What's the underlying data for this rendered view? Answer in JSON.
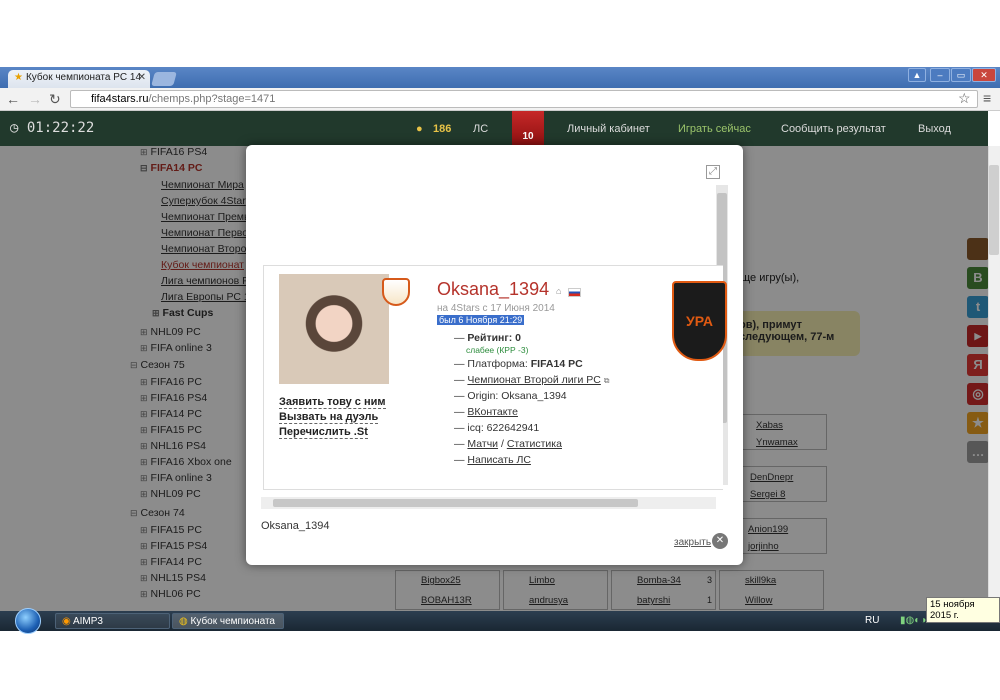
{
  "browser": {
    "tab_title": "Кубок чемпионата PC 14",
    "tab_close": "✕",
    "url_host": "fifa4stars.ru",
    "url_path": "/chemps.php?stage=1471",
    "window_controls": [
      "▲",
      "–",
      "▭",
      "✕"
    ]
  },
  "header": {
    "timer": "01:22:22",
    "coins": "186",
    "pm": "ЛС",
    "player_number": "10",
    "nav": [
      "Личный кабинет",
      "Играть сейчас",
      "Сообщить результат",
      "Выход"
    ]
  },
  "tree": {
    "top_items": [
      "FIFA16 PS4",
      "FIFA14 PC"
    ],
    "sub_items": [
      "Чемпионат Мира",
      "Суперкубок 4Star",
      "Чемпионат Премь",
      "Чемпионат Перво",
      "Чемпионат Второ",
      "Кубок чемпионат",
      "Лига чемпионов Р",
      "Лига Европы РС 1"
    ],
    "fast_cups": "Fast Cups",
    "after_items": [
      "NHL09 PC",
      "FIFA online 3"
    ],
    "season75": "Сезон 75",
    "season75_items": [
      "FIFA16 PC",
      "FIFA16 PS4",
      "FIFA14 PC",
      "FIFA15 PC",
      "NHL16 PS4",
      "FIFA16 Xbox one",
      "FIFA online 3",
      "NHL09 PC"
    ],
    "season74": "Сезон 74",
    "season74_items": [
      "FIFA15 PC",
      "FIFA15 PS4",
      "FIFA14 PC",
      "NHL15 PS4",
      "NHL06 PC"
    ]
  },
  "background": {
    "note": "еще игру(ы),",
    "yellow_line1": "ов), примут",
    "yellow_line2": "следующем, 77-м",
    "box1": [
      "Xabas",
      "Ynwamax"
    ],
    "box2": [
      "DenDnepr",
      "Sergei 8"
    ],
    "box3": [
      "Anion199",
      "jorjinho"
    ],
    "bottom_rows": [
      [
        "Bigbox25",
        "Limbo",
        "Bomba-34",
        "3",
        "skill9ka"
      ],
      [
        "BOBAH13R",
        "andrusya",
        "batyrshi",
        "1",
        "Willow"
      ]
    ]
  },
  "modal": {
    "expand_icon": "⤢",
    "username": "Oksana_1394",
    "flag_icon": "russian-flag",
    "since": "на 4Stars с 17 Июня 2014",
    "last_seen": "был 6 Ноября 21:29",
    "rating": "Рейтинг: 0",
    "weaker": "слабее (КРР -3)",
    "platform_label": "Платформа:",
    "platform_value": "FIFA14 PC",
    "championship": "Чемпионат Второй лиги PC",
    "origin": "Origin: Oksana_1394",
    "vk": "ВКонтакте",
    "icq": "icq: 622642941",
    "matches": "Матчи",
    "slash": "/",
    "stats": "Статистика",
    "write_pm": "Написать ЛС",
    "actions": [
      "Заявить тову с ним",
      "Вызвать на дуэль",
      "Перечислить .St"
    ],
    "club_text": "УРА",
    "caption": "Oksana_1394",
    "close_label": "закрыть",
    "dash": "—"
  },
  "taskbar": {
    "aimp": "AIMP3",
    "browser_task": "Кубок чемпионата ...",
    "lang": "RU",
    "clock": "8:22",
    "tooltip": "15 ноября 2015 г."
  },
  "colors": {
    "header_bg": "#21392c",
    "username": "#b5332b",
    "accent_link": "#3a6ecb"
  }
}
